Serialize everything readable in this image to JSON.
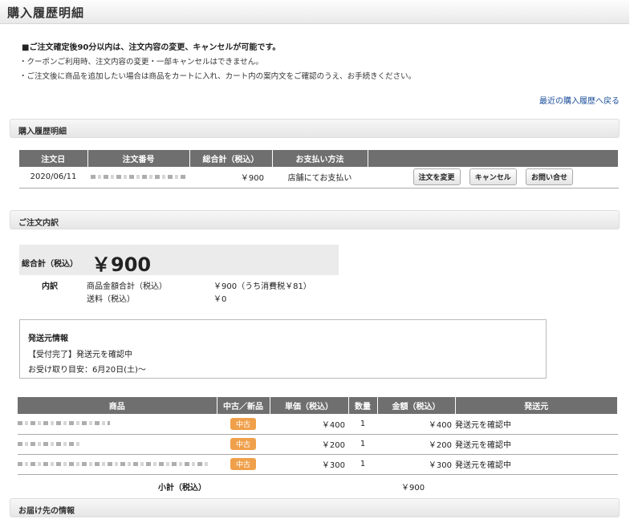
{
  "header": {
    "title": "購入履歴明細"
  },
  "notices": {
    "bold": "■ご注文確定後90分以内は、注文内容の変更、キャンセルが可能です。",
    "line1": "・クーポンご利用時、注文内容の変更・一部キャンセルはできません。",
    "line2": "・ご注文後に商品を追加したい場合は商品をカートに入れ、カート内の案内文をご確認のうえ、お手続きください。"
  },
  "back_link": "最近の購入履歴へ戻る",
  "section_history": "購入履歴明細",
  "order_table": {
    "headers": [
      "注文日",
      "注文番号",
      "総合計（税込）",
      "お支払い方法",
      ""
    ],
    "row": {
      "date": "2020/06/11",
      "total": "￥900",
      "payment": "店舗にてお支払い"
    },
    "buttons": {
      "change": "注文を変更",
      "cancel": "キャンセル",
      "inquiry": "お問い合せ"
    }
  },
  "section_detail": "ご注文内訳",
  "summary": {
    "total_label": "総合計（税込）",
    "total_value": "￥900",
    "breakdown_label": "内訳",
    "subtotal_label": "商品金額合計（税込）",
    "subtotal_value": "￥900（うち消費税￥81）",
    "shipping_label": "送料（税込）",
    "shipping_value": "￥0"
  },
  "shipping_info": {
    "title": "発送元情報",
    "status": "【受付完了】発送元を確認中",
    "eta": "お受け取り目安：6月20日(土)～"
  },
  "items_table": {
    "headers": [
      "商品",
      "中古／新品",
      "単価（税込）",
      "数量",
      "金額（税込）",
      "発送元"
    ],
    "rows": [
      {
        "condition": "中古",
        "unit_price": "￥400",
        "qty": "1",
        "amount": "￥400",
        "source": "発送元を確認中"
      },
      {
        "condition": "中古",
        "unit_price": "￥200",
        "qty": "1",
        "amount": "￥200",
        "source": "発送元を確認中"
      },
      {
        "condition": "中古",
        "unit_price": "￥300",
        "qty": "1",
        "amount": "￥300",
        "source": "発送元を確認中"
      }
    ],
    "subtotal_label": "小計（税込）",
    "subtotal_value": "￥900"
  },
  "section_delivery": "お届け先の情報",
  "colors": {
    "header_bg": "#6f6f6f",
    "badge": "#f0a04b",
    "link": "#1a4e9a"
  }
}
